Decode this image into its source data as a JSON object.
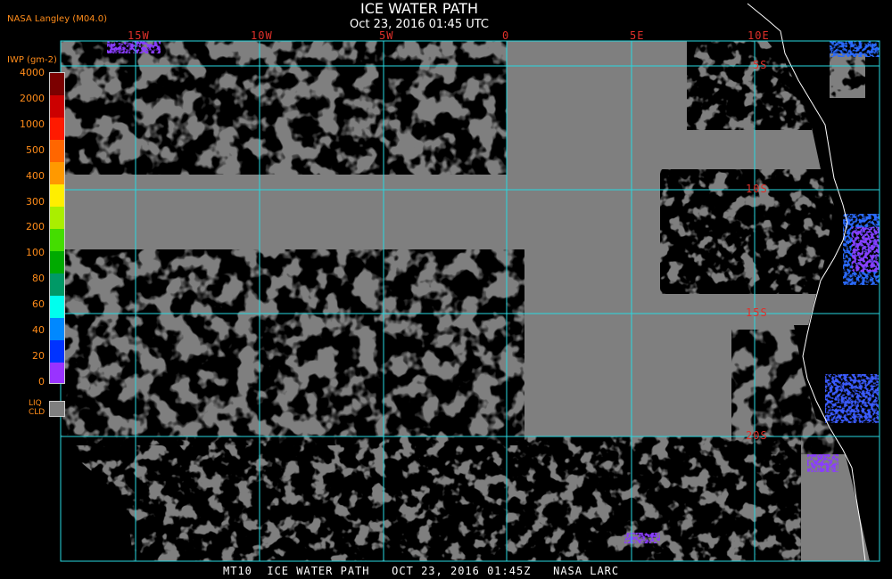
{
  "header": {
    "title": "ICE WATER PATH",
    "subtitle": "Oct 23, 2016 01:45 UTC",
    "organization": "NASA Langley (M04.0)"
  },
  "legend": {
    "units": "IWP (gm-2)",
    "ticks": [
      "4000",
      "2000",
      "1000",
      "500",
      "400",
      "300",
      "200",
      "100",
      "80",
      "60",
      "40",
      "20",
      "0"
    ],
    "colors": [
      "#7b0000",
      "#cc0000",
      "#ff1a00",
      "#ff6600",
      "#ff9900",
      "#ffee00",
      "#aaee00",
      "#44dd00",
      "#00aa00",
      "#009966",
      "#00ffee",
      "#0088ff",
      "#0033ff",
      "#9933ff"
    ],
    "liquid_cloud_label_1": "LIQ",
    "liquid_cloud_label_2": "CLD",
    "liquid_cloud_color": "#7f7f7f"
  },
  "map": {
    "longitude_labels": [
      "15W",
      "10W",
      "5W",
      "0",
      "5E",
      "10E"
    ],
    "latitude_labels": [
      "5S",
      "10S",
      "15S",
      "20S"
    ],
    "grid_color": "#27d8e0",
    "cloud_color": "#7f7f7f",
    "clear_color": "#000000",
    "coast_color": "#ffffff"
  },
  "footer": {
    "text": "MT10  ICE WATER PATH   OCT 23, 2016 01:45Z   NASA LARC"
  }
}
